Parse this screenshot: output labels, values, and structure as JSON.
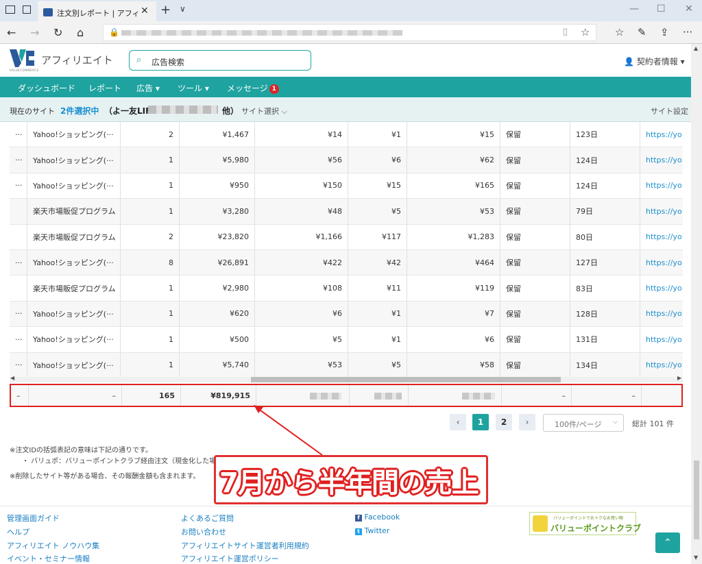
{
  "browser": {
    "tab_title": "注文別レポート | アフィリエ·",
    "close_glyph": "✕",
    "newtab_glyph": "+",
    "tabmenu_glyph": "∨",
    "min_glyph": "—",
    "max_glyph": "☐",
    "winclose_glyph": "✕",
    "back_glyph": "←",
    "forward_glyph": "→",
    "refresh_glyph": "↻",
    "home_glyph": "⌂",
    "lock_glyph": "🔒",
    "reader_glyph": "▯",
    "star_glyph": "☆",
    "favorites_glyph": "☆",
    "pen_glyph": "✎",
    "share_glyph": "⇪",
    "more_glyph": "···"
  },
  "header": {
    "brand": "アフィリエイト",
    "brand_sub": "VALUECOMMERCE",
    "search_placeholder": "広告検索",
    "search_icon": "⌕",
    "account_label": "契約者情報 ▾",
    "account_icon": "👤"
  },
  "nav": {
    "items": [
      "ダッシュボード",
      "レポート",
      "広告 ▾",
      "ツール ▾",
      "メッセージ"
    ],
    "message_badge": "1"
  },
  "sitebar": {
    "current_label": "現在のサイト",
    "selected_count": "2件選択中",
    "site_name_prefix": "（よ一友LIFE",
    "site_name_suffix": "他）",
    "site_select": "サイト選択 ⌵",
    "site_settings": "サイト設定"
  },
  "table": {
    "rows": [
      {
        "lead": "···",
        "program": "Yahoo!ショッピング(···",
        "qty": "2",
        "sales": "¥1,467",
        "reward": "¥14",
        "tax": "¥1",
        "total": "¥15",
        "status": "保留",
        "days": "123日",
        "url": "https://yo"
      },
      {
        "lead": "···",
        "program": "Yahoo!ショッピング(···",
        "qty": "1",
        "sales": "¥5,980",
        "reward": "¥56",
        "tax": "¥6",
        "total": "¥62",
        "status": "保留",
        "days": "124日",
        "url": "https://yo"
      },
      {
        "lead": "···",
        "program": "Yahoo!ショッピング(···",
        "qty": "1",
        "sales": "¥950",
        "reward": "¥150",
        "tax": "¥15",
        "total": "¥165",
        "status": "保留",
        "days": "124日",
        "url": "https://yo"
      },
      {
        "lead": "",
        "program": "楽天市場販促プログラム",
        "qty": "1",
        "sales": "¥3,280",
        "reward": "¥48",
        "tax": "¥5",
        "total": "¥53",
        "status": "保留",
        "days": "79日",
        "url": "https://yo"
      },
      {
        "lead": "",
        "program": "楽天市場販促プログラム",
        "qty": "2",
        "sales": "¥23,820",
        "reward": "¥1,166",
        "tax": "¥117",
        "total": "¥1,283",
        "status": "保留",
        "days": "80日",
        "url": "https://yo"
      },
      {
        "lead": "···",
        "program": "Yahoo!ショッピング(···",
        "qty": "8",
        "sales": "¥26,891",
        "reward": "¥422",
        "tax": "¥42",
        "total": "¥464",
        "status": "保留",
        "days": "127日",
        "url": "https://yo"
      },
      {
        "lead": "",
        "program": "楽天市場販促プログラム",
        "qty": "1",
        "sales": "¥2,980",
        "reward": "¥108",
        "tax": "¥11",
        "total": "¥119",
        "status": "保留",
        "days": "83日",
        "url": "https://yo"
      },
      {
        "lead": "···",
        "program": "Yahoo!ショッピング(···",
        "qty": "1",
        "sales": "¥620",
        "reward": "¥6",
        "tax": "¥1",
        "total": "¥7",
        "status": "保留",
        "days": "128日",
        "url": "https://yo"
      },
      {
        "lead": "···",
        "program": "Yahoo!ショッピング(···",
        "qty": "1",
        "sales": "¥500",
        "reward": "¥5",
        "tax": "¥1",
        "total": "¥6",
        "status": "保留",
        "days": "131日",
        "url": "https://yo"
      },
      {
        "lead": "···",
        "program": "Yahoo!ショッピング(···",
        "qty": "1",
        "sales": "¥5,740",
        "reward": "¥53",
        "tax": "¥5",
        "total": "¥58",
        "status": "保留",
        "days": "134日",
        "url": "https://yo"
      }
    ],
    "total": {
      "lead": "–",
      "program": "–",
      "qty": "165",
      "sales": "¥819,915",
      "status": "–",
      "days": "–"
    }
  },
  "pager": {
    "prev": "‹",
    "pages": [
      "1",
      "2"
    ],
    "next": "›",
    "page_size": "100件/ページ",
    "total_count": "総計 101 件"
  },
  "notes": {
    "line1": "※注文IDの括弧表記の意味は下記の通りです。",
    "line2": "・ バリュポ：バリューポイントクラブ経由注文（現金化した場",
    "line3": "※削除したサイト等がある場合、その報酬金額も含まれます。"
  },
  "callout": {
    "text": "7月から半年間の売上"
  },
  "footer": {
    "col1": [
      "管理画面ガイド",
      "ヘルプ",
      "アフィリエイト ノウハウ集",
      "イベント・セミナー情報"
    ],
    "col2": [
      "よくあるご質問",
      "お問い合わせ",
      "アフィリエイトサイト運営者利用規約",
      "アフィリエイト運営ポリシー"
    ],
    "col3": [
      "Facebook",
      "Twitter"
    ],
    "facebook_icon": "f",
    "twitter_icon": "t",
    "banner_small": "バリューポイントでおトクなお買い物",
    "banner_main": "バリューポイントクラブ",
    "totop": "⌃"
  },
  "colors": {
    "accent": "#1fa3a0",
    "link": "#1a8fd0",
    "highlight": "#e02020"
  }
}
